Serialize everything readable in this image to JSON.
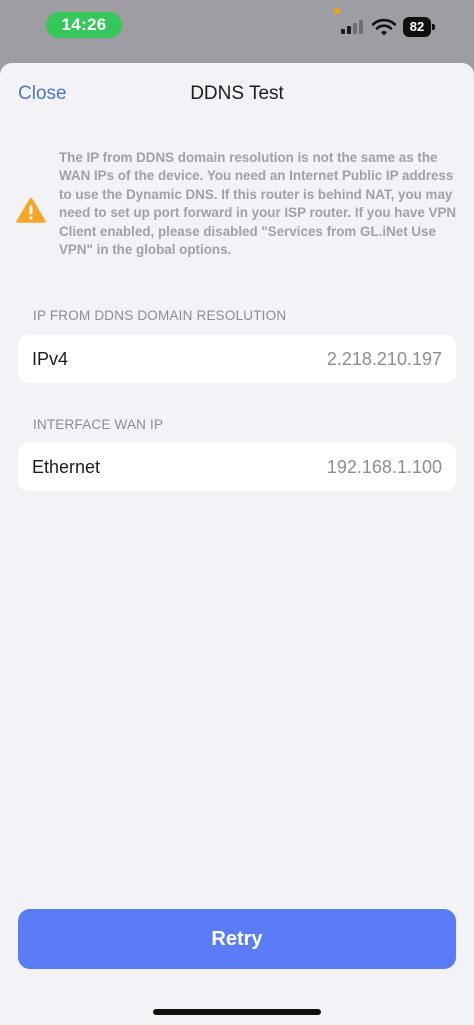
{
  "status_bar": {
    "time": "14:26",
    "battery_level": "82",
    "signal_bars_active": 2,
    "icons": [
      "signal-icon",
      "wifi-icon",
      "battery-icon"
    ],
    "colors": {
      "time_pill": "#34c759",
      "mic_indicator": "#ff9f0a"
    }
  },
  "header": {
    "close_label": "Close",
    "title": "DDNS Test"
  },
  "warning": {
    "icon": "warning-icon",
    "icon_color": "#f5a623",
    "text": "The IP from DDNS domain resolution is not the same as the WAN IPs of the device. You need an Internet Public IP address to use the Dynamic DNS. If this router is behind NAT, you may need to set up port forward in your ISP router. If you have VPN Client enabled, please disabled \"Services from GL.iNet Use VPN\" in the global options."
  },
  "sections": {
    "ddns": {
      "header": "IP FROM DDNS DOMAIN RESOLUTION",
      "label": "IPv4",
      "value": "2.218.210.197"
    },
    "wan": {
      "header": "INTERFACE WAN IP",
      "label": "Ethernet",
      "value": "192.168.1.100"
    }
  },
  "actions": {
    "retry_label": "Retry",
    "accent_color": "#5a7cf6"
  }
}
